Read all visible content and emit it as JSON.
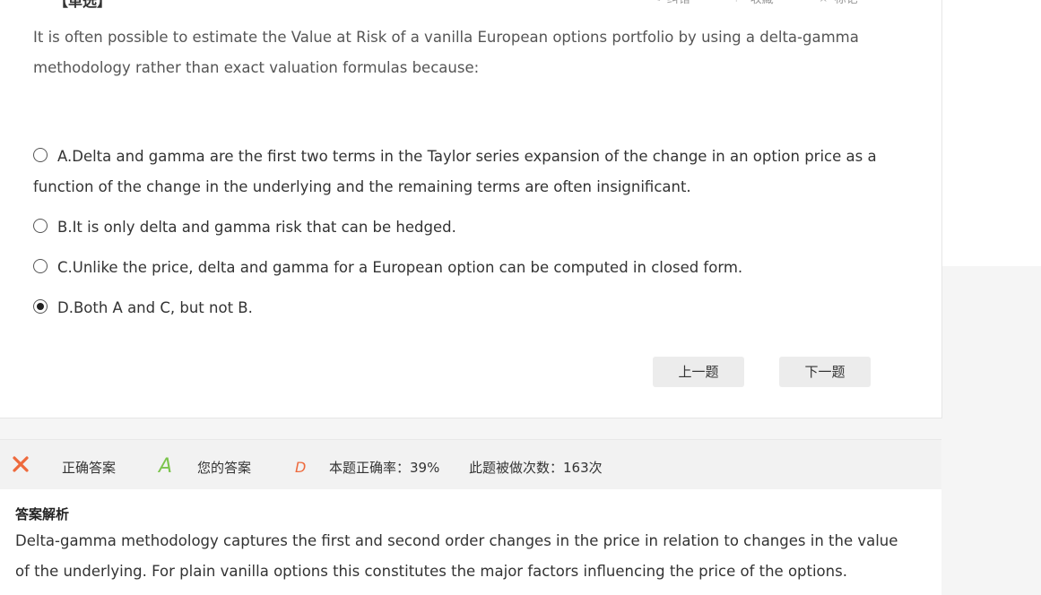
{
  "toolbar": {
    "title": "【单选】",
    "items": [
      {
        "label": "纠错",
        "icon": "edit-icon"
      },
      {
        "label": "收藏",
        "icon": "bookmark-icon"
      },
      {
        "label": "标记",
        "icon": "star-icon"
      }
    ]
  },
  "question": {
    "text": "It is often possible to estimate the Value at Risk of a vanilla European options portfolio by using a delta-gamma methodology rather than exact valuation formulas because:",
    "options": [
      {
        "label": "A.Delta and gamma are the first two terms in the Taylor series expansion of the change in an option price as a function of the change in the underlying and the remaining terms are often insignificant.",
        "checked": false
      },
      {
        "label": "B.It is only delta and gamma risk that can be hedged.",
        "checked": false
      },
      {
        "label": "C.Unlike the price, delta and gamma for a European option can be computed in closed form.",
        "checked": false
      },
      {
        "label": "D.Both A and C, but not B.",
        "checked": true
      }
    ]
  },
  "nav": {
    "prev_label": "上一题",
    "next_label": "下一题"
  },
  "result": {
    "status_icon": "wrong-x-icon",
    "correct_answer_label": "正确答案",
    "correct_answer": "A",
    "your_answer_label": "您的答案",
    "your_answer": "D",
    "accuracy": "本题正确率：39%",
    "attempts": "此题被做次数：163次",
    "colors": {
      "wrong": "#ee6a3d",
      "correct": "#7cc44d"
    }
  },
  "analysis": {
    "title": "答案解析",
    "body": "Delta-gamma methodology captures the first and second order changes in the price in relation to changes in the value of the underlying. For plain vanilla options this constitutes the major factors influencing the price of the options."
  }
}
